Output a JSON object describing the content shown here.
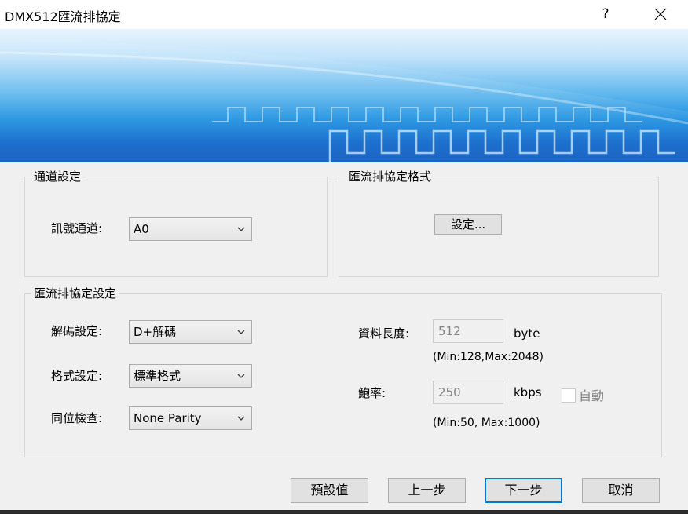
{
  "window": {
    "title": "DMX512匯流排協定",
    "help_glyph": "?",
    "close_glyph": "✕"
  },
  "channel_group": {
    "title": "通道設定",
    "signal_channel_label": "訊號通道:",
    "signal_channel_value": "A0"
  },
  "format_group": {
    "title": "匯流排協定格式",
    "settings_button": "設定..."
  },
  "protocol_group": {
    "title": "匯流排協定設定",
    "decode_label": "解碼設定:",
    "decode_value": "D+解碼",
    "format_label": "格式設定:",
    "format_value": "標準格式",
    "parity_label": "同位檢查:",
    "parity_value": "None Parity",
    "data_length_label": "資料長度:",
    "data_length_value": "512",
    "data_length_unit": "byte",
    "data_length_hint": "(Min:128,Max:2048)",
    "baud_label": "鮑率:",
    "baud_value": "250",
    "baud_unit": "kbps",
    "baud_hint": "(Min:50, Max:1000)",
    "auto_label": "自動"
  },
  "footer": {
    "defaults_button": "預設值",
    "prev_button": "上一步",
    "next_button": "下一步",
    "cancel_button": "取消"
  },
  "colors": {
    "accent": "#0078d7",
    "banner_dark": "#0a57be",
    "banner_light": "#e9f4fd"
  }
}
